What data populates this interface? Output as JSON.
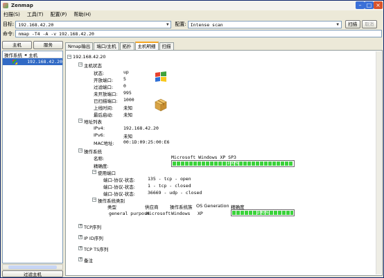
{
  "window": {
    "title": "Zenmap"
  },
  "menu": [
    "扫描(S)",
    "工具(T)",
    "配置(P)",
    "帮助(H)"
  ],
  "toolbar": {
    "target_label": "目标:",
    "target_value": "192.168.42.20",
    "profile_label": "配置:",
    "profile_value": "Intense scan",
    "scan_button": "扫描",
    "cancel_button": "取消",
    "command_label": "命令:",
    "command_value": "nmap -T4 -A -v 192.168.42.20"
  },
  "left": {
    "hosts_button": "主机",
    "services_button": "服务",
    "col_os": "操作系统",
    "col_host": "主机",
    "host_row": "192.168.42.20",
    "filter_button": "过滤主机"
  },
  "tabs": [
    "Nmap输出",
    "端口/主机",
    "拓扑",
    "主机明细",
    "扫描"
  ],
  "details": {
    "host_title": "192.168.42.20",
    "status_section": "主机状态",
    "status": {
      "state_label": "状态:",
      "state_value": "up",
      "open_label": "开放端口:",
      "open_value": "5",
      "filtered_label": "过滤端口:",
      "filtered_value": "0",
      "closed_label": "未开放端口:",
      "closed_value": "995",
      "scanned_label": "已扫描端口:",
      "scanned_value": "1000",
      "uptime_label": "上线时间:",
      "uptime_value": "未知",
      "lastboot_label": "最后启动:",
      "lastboot_value": "未知"
    },
    "address_section": "地址列表",
    "address": {
      "ipv4_label": "IPv4:",
      "ipv4_value": "192.168.42.20",
      "ipv6_label": "IPv6:",
      "ipv6_value": "未知",
      "mac_label": "MAC地址:",
      "mac_value": "00:1D:09:25:00:E6"
    },
    "os_section": "操作系统",
    "os": {
      "name_label": "名称:",
      "name_value": "Microsoft Windows XP SP3",
      "accuracy_label": "精确度:",
      "accuracy_value": "100%",
      "ports_used_section": "使用端口",
      "port_label": "端口-协议-状态:",
      "port1": "135 - tcp - open",
      "port2": "1 - tcp - closed",
      "port3": "36669 - udp - closed",
      "os_class_section": "操作系统类别",
      "class_headers": [
        "类型",
        "供应商",
        "操作系统族",
        "OS Generation",
        "精确度"
      ],
      "class_row": {
        "type": "general purpose",
        "vendor": "Microsoft",
        "family": "Windows",
        "gen": "XP",
        "accuracy": "100%"
      }
    },
    "collapsed": [
      "TCP序列",
      "IP ID序列",
      "TCP TS序列",
      "备注"
    ]
  },
  "colors": {
    "selection": "#316ac5",
    "progress": "#3bd23b",
    "tab_accent": "#f5a623"
  },
  "icons": [
    "windows-logo-icon",
    "package-box-icon",
    "expander-icon"
  ]
}
